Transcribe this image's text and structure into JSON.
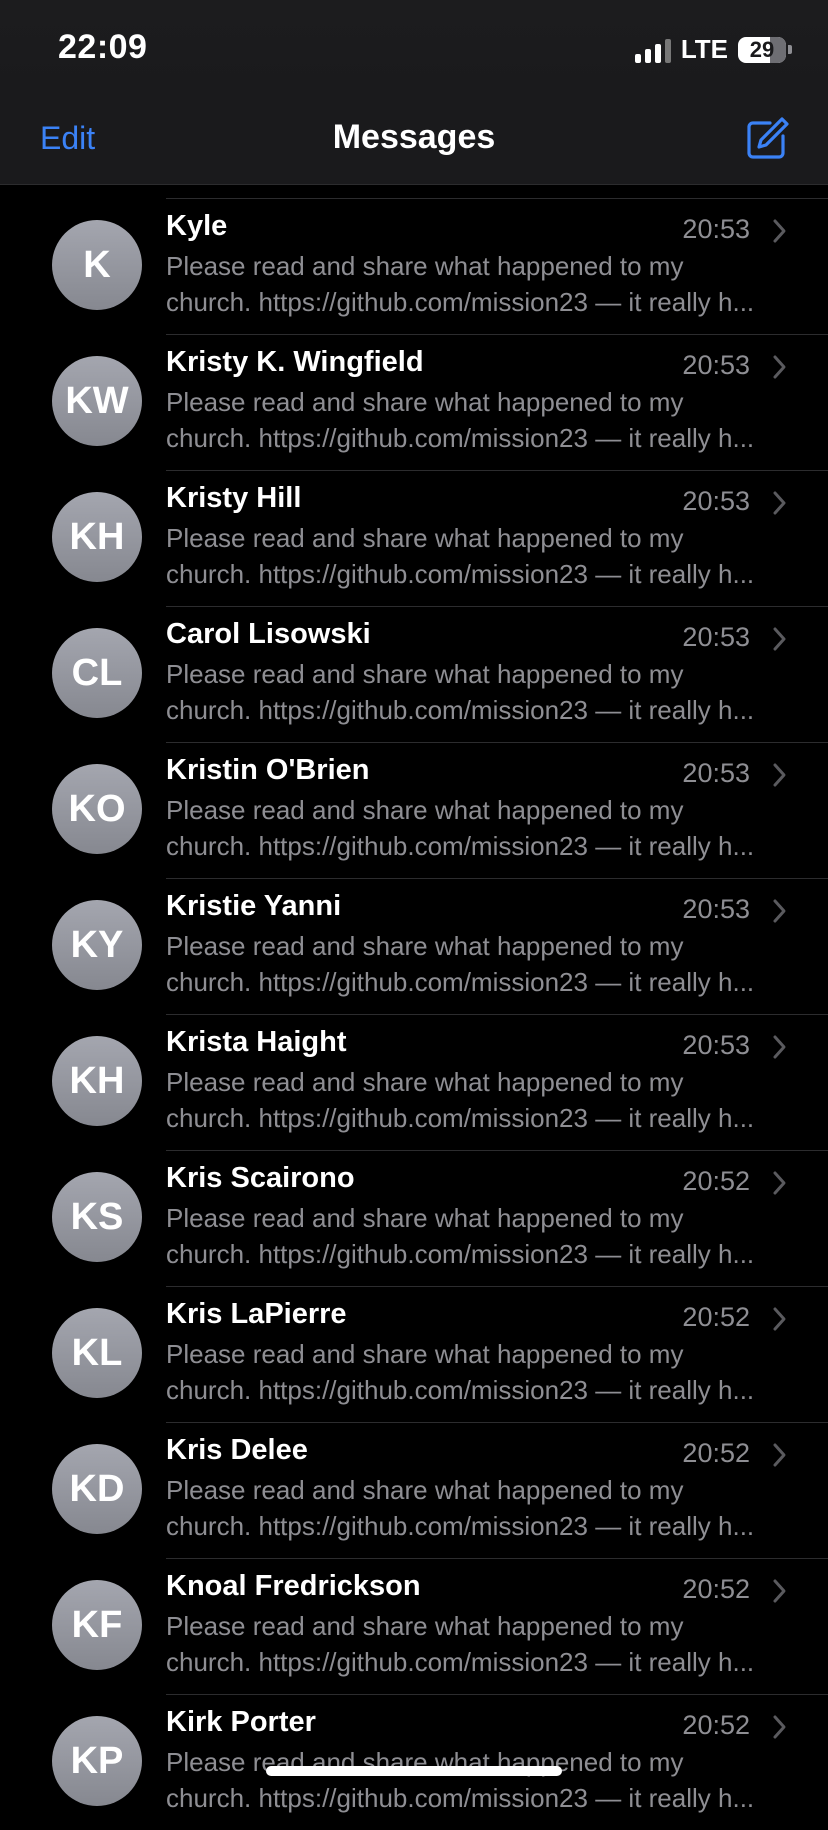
{
  "status_bar": {
    "time": "22:09",
    "network": "LTE",
    "battery": "29"
  },
  "nav": {
    "edit_label": "Edit",
    "title": "Messages",
    "compose_icon": "compose-icon",
    "accent_color": "#3b82f6"
  },
  "conversations": [
    {
      "initials": "K",
      "name": "Kyle",
      "time": "20:53",
      "preview_line1": "Please read and share what happened to my",
      "preview_line2": "church. https://github.com/mission23 — it really h..."
    },
    {
      "initials": "KW",
      "name": "Kristy K. Wingfield",
      "time": "20:53",
      "preview_line1": "Please read and share what happened to my",
      "preview_line2": "church. https://github.com/mission23 — it really h..."
    },
    {
      "initials": "KH",
      "name": "Kristy Hill",
      "time": "20:53",
      "preview_line1": "Please read and share what happened to my",
      "preview_line2": "church. https://github.com/mission23 — it really h..."
    },
    {
      "initials": "CL",
      "name": "Carol Lisowski",
      "time": "20:53",
      "preview_line1": "Please read and share what happened to my",
      "preview_line2": "church. https://github.com/mission23 — it really h..."
    },
    {
      "initials": "KO",
      "name": "Kristin O'Brien",
      "time": "20:53",
      "preview_line1": "Please read and share what happened to my",
      "preview_line2": "church. https://github.com/mission23 — it really h..."
    },
    {
      "initials": "KY",
      "name": "Kristie Yanni",
      "time": "20:53",
      "preview_line1": "Please read and share what happened to my",
      "preview_line2": "church. https://github.com/mission23 — it really h..."
    },
    {
      "initials": "KH",
      "name": "Krista Haight",
      "time": "20:53",
      "preview_line1": "Please read and share what happened to my",
      "preview_line2": "church. https://github.com/mission23 — it really h..."
    },
    {
      "initials": "KS",
      "name": "Kris Scairono",
      "time": "20:52",
      "preview_line1": "Please read and share what happened to my",
      "preview_line2": "church. https://github.com/mission23 — it really h..."
    },
    {
      "initials": "KL",
      "name": "Kris LaPierre",
      "time": "20:52",
      "preview_line1": "Please read and share what happened to my",
      "preview_line2": "church. https://github.com/mission23 — it really h..."
    },
    {
      "initials": "KD",
      "name": "Kris Delee",
      "time": "20:52",
      "preview_line1": "Please read and share what happened to my",
      "preview_line2": "church. https://github.com/mission23 — it really h..."
    },
    {
      "initials": "KF",
      "name": "Knoal Fredrickson",
      "time": "20:52",
      "preview_line1": "Please read and share what happened to my",
      "preview_line2": "church. https://github.com/mission23 — it really h..."
    },
    {
      "initials": "KP",
      "name": "Kirk Porter",
      "time": "20:52",
      "preview_line1": "Please read and share what happened to my",
      "preview_line2": "church. https://github.com/mission23 — it really h..."
    }
  ]
}
